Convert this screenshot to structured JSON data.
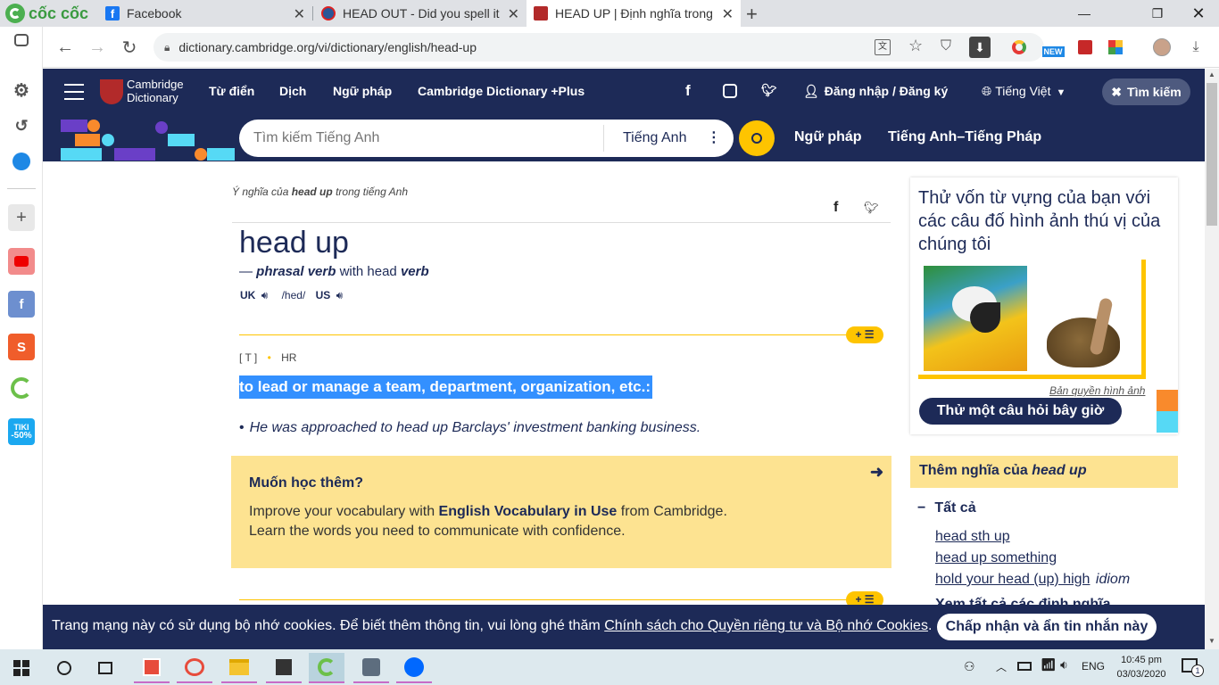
{
  "browser": {
    "brand": "cốc cốc",
    "tabs": [
      {
        "title": "Facebook"
      },
      {
        "title": "HEAD OUT - Did you spell it c"
      },
      {
        "title": "HEAD UP | Định nghĩa trong T"
      }
    ],
    "url": "dictionary.cambridge.org/vi/dictionary/english/head-up",
    "badge_new": "NEW"
  },
  "sidebar": {
    "tiki_label": "TIKI",
    "tiki_badge": "-50%"
  },
  "header": {
    "logo_line1": "Cambridge",
    "logo_line2": "Dictionary",
    "nav": [
      "Từ điển",
      "Dịch",
      "Ngữ pháp",
      "Cambridge Dictionary +Plus"
    ],
    "login": "Đăng nhập / Đăng ký",
    "language": "Tiếng Việt",
    "search_button": "Tìm kiếm"
  },
  "search": {
    "placeholder": "Tìm kiếm Tiếng Anh",
    "dictionary": "Tiếng Anh",
    "links": [
      "Ngữ pháp",
      "Tiếng Anh–Tiếng Pháp"
    ]
  },
  "entry": {
    "breadcrumb_prefix": "Ý nghĩa của ",
    "breadcrumb_word": "head up",
    "breadcrumb_suffix": " trong tiếng Anh",
    "headword": "head up",
    "pos_dash": "—",
    "pos": "phrasal verb",
    "pos_with": "with head",
    "pos_verb": "verb",
    "uk": "UK",
    "us": "US",
    "pron": "/hed/",
    "grammar": "[ T ]",
    "domain": "HR",
    "definition": "to lead or manage a team, department, organization, etc.:",
    "example": "He was approached to head up Barclays' investment banking business."
  },
  "promo": {
    "title": "Muốn học thêm?",
    "text1_prefix": "Improve your vocabulary with ",
    "text1_bold": "English Vocabulary in Use",
    "text1_suffix": " from Cambridge.",
    "text2": "Learn the words you need to communicate with confidence."
  },
  "quiz": {
    "heading": "Thử vốn từ vựng của bạn với các câu đố hình ảnh thú vị của chúng tôi",
    "credit": "Bản quyền hình ảnh",
    "button": "Thử một câu hỏi bây giờ"
  },
  "more": {
    "title_prefix": "Thêm nghĩa của ",
    "title_word": "head up",
    "all": "Tất cả",
    "links": [
      "head sth up",
      "head up something",
      "hold your head (up) high"
    ],
    "idiom": "idiom",
    "see_all": "Xem tất cả các định nghĩa"
  },
  "cookie": {
    "text": "Trang mạng này có sử dụng bộ nhớ cookies. Để biết thêm thông tin, vui lòng ghé thăm ",
    "link": "Chính sách cho Quyền riêng tư và Bộ nhớ Cookies",
    "end": ".",
    "button": "Chấp nhận và ẩn tin nhắn này"
  },
  "taskbar": {
    "lang": "ENG",
    "time": "10:45 pm",
    "date": "03/03/2020",
    "notif_count": "1"
  },
  "colors": {
    "navy": "#1d2a57",
    "yellow": "#fec400",
    "promo_bg": "#fde391",
    "highlight": "#3390ff"
  }
}
